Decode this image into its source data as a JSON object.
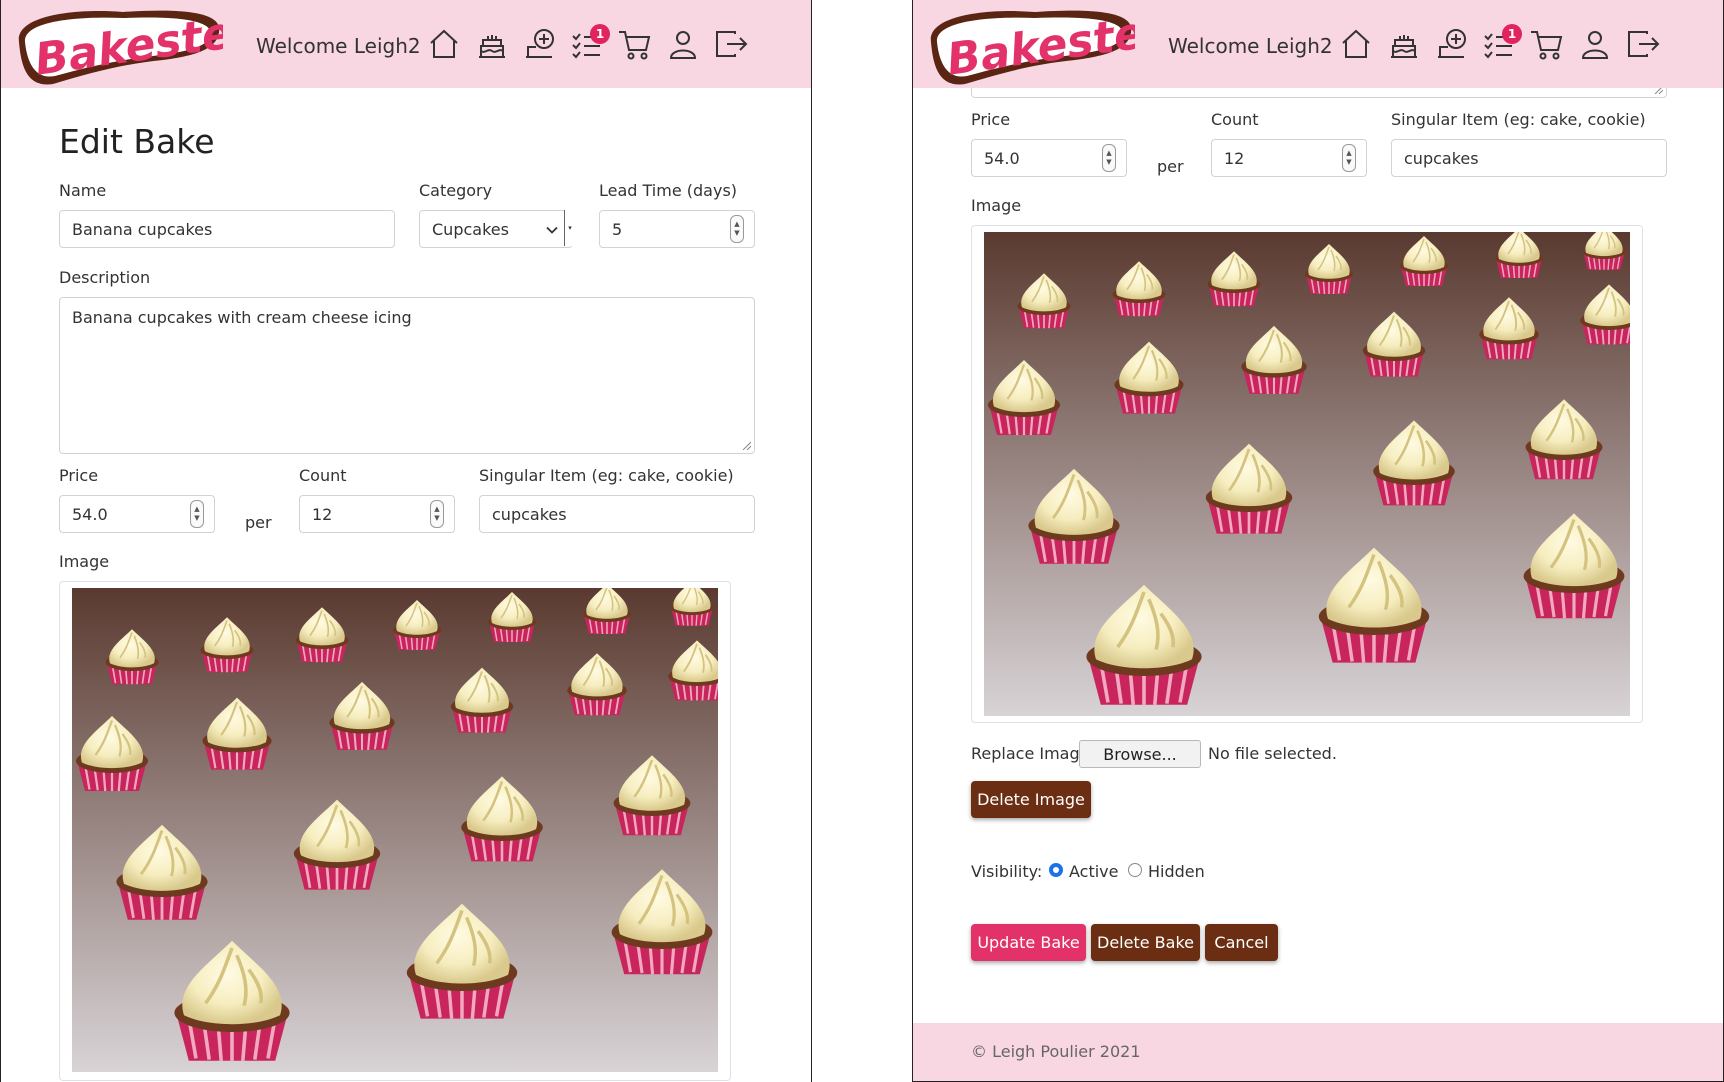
{
  "brand": {
    "logo_text": "Bakester",
    "pink": "#f8d7e2",
    "accent": "#e33269",
    "brown": "#6b2e12"
  },
  "nav": {
    "welcome": "Welcome Leigh2",
    "icons": [
      "home-icon",
      "cake-icon",
      "add-bake-icon",
      "orders-list-icon",
      "cart-icon",
      "user-icon",
      "logout-icon"
    ],
    "orders_badge": "1"
  },
  "form": {
    "title": "Edit Bake",
    "name_label": "Name",
    "name_value": "Banana cupcakes",
    "category_label": "Category",
    "category_value": "Cupcakes",
    "lead_time_label": "Lead Time (days)",
    "lead_time_value": "5",
    "description_label": "Description",
    "description_value": "Banana cupcakes with cream cheese icing",
    "price_label": "Price",
    "price_value": "54.0",
    "per_text": "per",
    "count_label": "Count",
    "count_value": "12",
    "singular_label": "Singular Item (eg: cake, cookie)",
    "singular_value": "cupcakes",
    "image_label": "Image",
    "replace_image_label": "Replace Image",
    "browse_label": "Browse...",
    "no_file_text": "No file selected.",
    "delete_image_label": "Delete Image",
    "visibility_label": "Visibility:",
    "visibility_options": [
      "Active",
      "Hidden"
    ],
    "visibility_selected": "Active",
    "update_label": "Update Bake",
    "delete_label": "Delete Bake",
    "cancel_label": "Cancel"
  },
  "footer": {
    "text": "© Leigh Poulier 2021"
  }
}
